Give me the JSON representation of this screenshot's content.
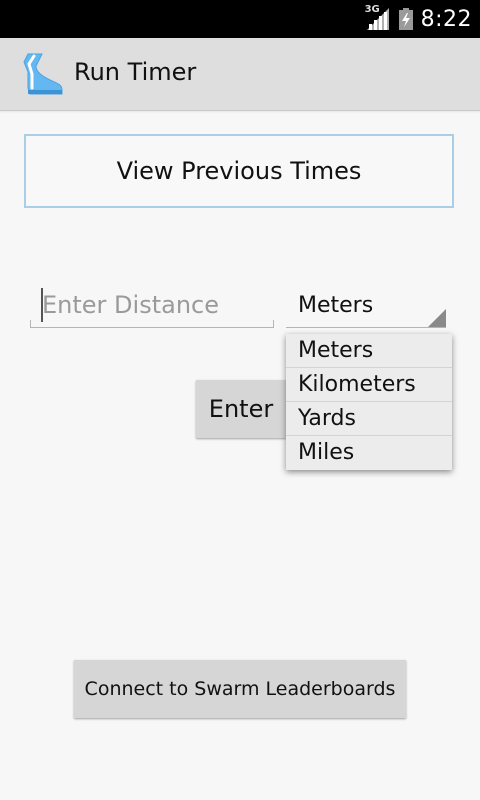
{
  "status_bar": {
    "network_label": "3G",
    "time": "8:22",
    "icons": [
      "signal-icon",
      "battery-icon"
    ]
  },
  "action_bar": {
    "title": "Run Timer",
    "icon": "shoe-icon"
  },
  "main": {
    "view_previous_label": "View Previous Times",
    "distance_input": {
      "value": "",
      "placeholder": "Enter Distance"
    },
    "unit_spinner": {
      "selected": "Meters",
      "options": [
        "Meters",
        "Kilometers",
        "Yards",
        "Miles"
      ]
    },
    "enter_label": "Enter",
    "swarm_label": "Connect to Swarm Leaderboards"
  },
  "colors": {
    "status_bar_bg": "#000000",
    "action_bar_bg": "#dedede",
    "button_bg": "#d6d6d6",
    "view_prev_border": "#a9cfe6",
    "icon_blue": "#63b8f2"
  }
}
